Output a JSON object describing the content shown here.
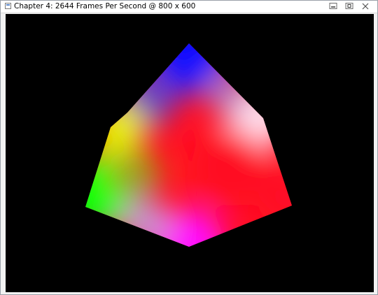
{
  "window": {
    "title": "Chapter 4: 2644 Frames Per Second @ 800 x 600",
    "controls": [
      "minimize-icon",
      "restore-icon",
      "close-icon"
    ]
  },
  "scene": {
    "background": "#000000",
    "object": "rotating cube",
    "vertex_colors": {
      "top": "#0000ff",
      "upper_right": "#ffffff",
      "upper_left": "#ffff00",
      "center": "#ff0000",
      "lower_left": "#00ff00",
      "right": "#ff0000",
      "bottom": "#ff00ff"
    }
  }
}
